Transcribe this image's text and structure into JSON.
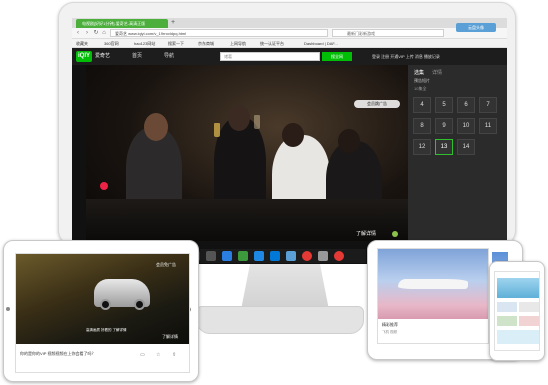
{
  "browser": {
    "tab_title": "电视剧[好好1分钟]-爱奇艺-高清正版",
    "url": "爱奇艺  www.iqiyi.com/v_19rrovldpq.html",
    "search_placeholder": "最新门彩新游戏",
    "cloud_button": "云盘头像",
    "bookmarks": [
      "收藏夹",
      "360官网",
      "hao123网站",
      "搜索一下",
      "京东商城",
      "上网导航",
      "统一认证平台",
      "Dashboard | DAF..."
    ]
  },
  "site": {
    "logo": "iQIY",
    "brand": "爱奇艺",
    "home": "首页",
    "nav": "导航",
    "search_placeholder": "诸葛",
    "search_button": "搜全网",
    "header_right": "登录  注册  开通VIP  上传  消息  播放记录"
  },
  "video": {
    "ad_skip": "会员跳广告",
    "detail": "了解详情"
  },
  "episodes": {
    "tabs": [
      "选集",
      "详情"
    ],
    "label": "预告短片",
    "count_label": "10集全",
    "numbers": [
      "4",
      "5",
      "6",
      "7",
      "8",
      "9",
      "10",
      "11",
      "12",
      "13",
      "14"
    ],
    "active": "13"
  },
  "tablet_left": {
    "vip": "会员免广告",
    "sub": "高清画质 好看的 了解详情",
    "detail": "了解详情",
    "caption": "你的是你的VIP  视频视频在上你会看了吗？"
  },
  "tablet_right": {
    "caption": "精彩推荐",
    "sub": "飞机 视频"
  }
}
